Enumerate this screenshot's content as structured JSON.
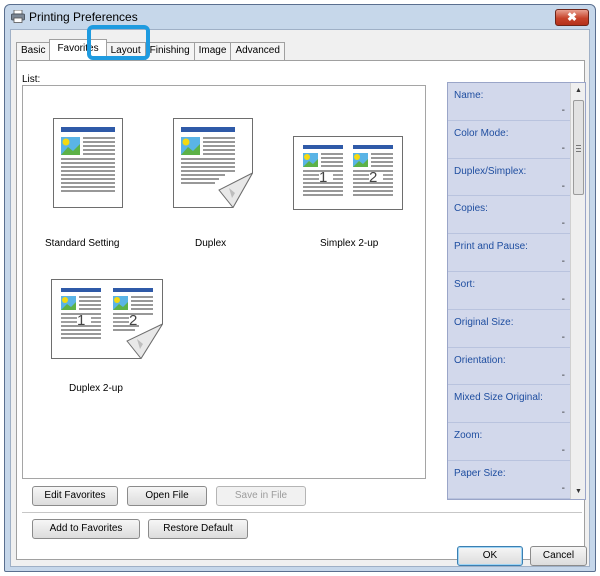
{
  "window": {
    "title": "Printing Preferences",
    "close_glyph": "✖"
  },
  "tabs": [
    {
      "label": "Basic"
    },
    {
      "label": "Favorites",
      "active": true
    },
    {
      "label": "Layout"
    },
    {
      "label": "Finishing"
    },
    {
      "label": "Image"
    },
    {
      "label": "Advanced"
    }
  ],
  "list": {
    "label": "List:",
    "items": [
      {
        "label": "Standard Setting",
        "icon": "single-page-icon"
      },
      {
        "label": "Duplex",
        "icon": "duplex-page-icon"
      },
      {
        "label": "Simplex 2-up",
        "icon": "simplex-2up-icon"
      },
      {
        "label": "Duplex 2-up",
        "icon": "duplex-2up-icon"
      }
    ]
  },
  "info_panel": {
    "rows": [
      {
        "name": "Name:",
        "value": "-"
      },
      {
        "name": "Color Mode:",
        "value": "-"
      },
      {
        "name": "Duplex/Simplex:",
        "value": "-"
      },
      {
        "name": "Copies:",
        "value": "-"
      },
      {
        "name": "Print and Pause:",
        "value": "-"
      },
      {
        "name": "Sort:",
        "value": "-"
      },
      {
        "name": "Original Size:",
        "value": "-"
      },
      {
        "name": "Orientation:",
        "value": "-"
      },
      {
        "name": "Mixed Size Original:",
        "value": "-"
      },
      {
        "name": "Zoom:",
        "value": "-"
      },
      {
        "name": "Paper Size:",
        "value": "-"
      }
    ],
    "scroll_up": "▲",
    "scroll_down": "▼"
  },
  "buttons": {
    "edit_favorites": "Edit Favorites",
    "open_file": "Open File",
    "save_in_file": "Save in File",
    "add_to_favorites": "Add to Favorites",
    "restore_default": "Restore Default",
    "ok": "OK",
    "cancel": "Cancel"
  },
  "page_numbers": {
    "left": "1",
    "right": "2"
  },
  "colors": {
    "accent": "#1e9be0",
    "info_label": "#1f4ea0",
    "page_header": "#2f5aa8"
  }
}
